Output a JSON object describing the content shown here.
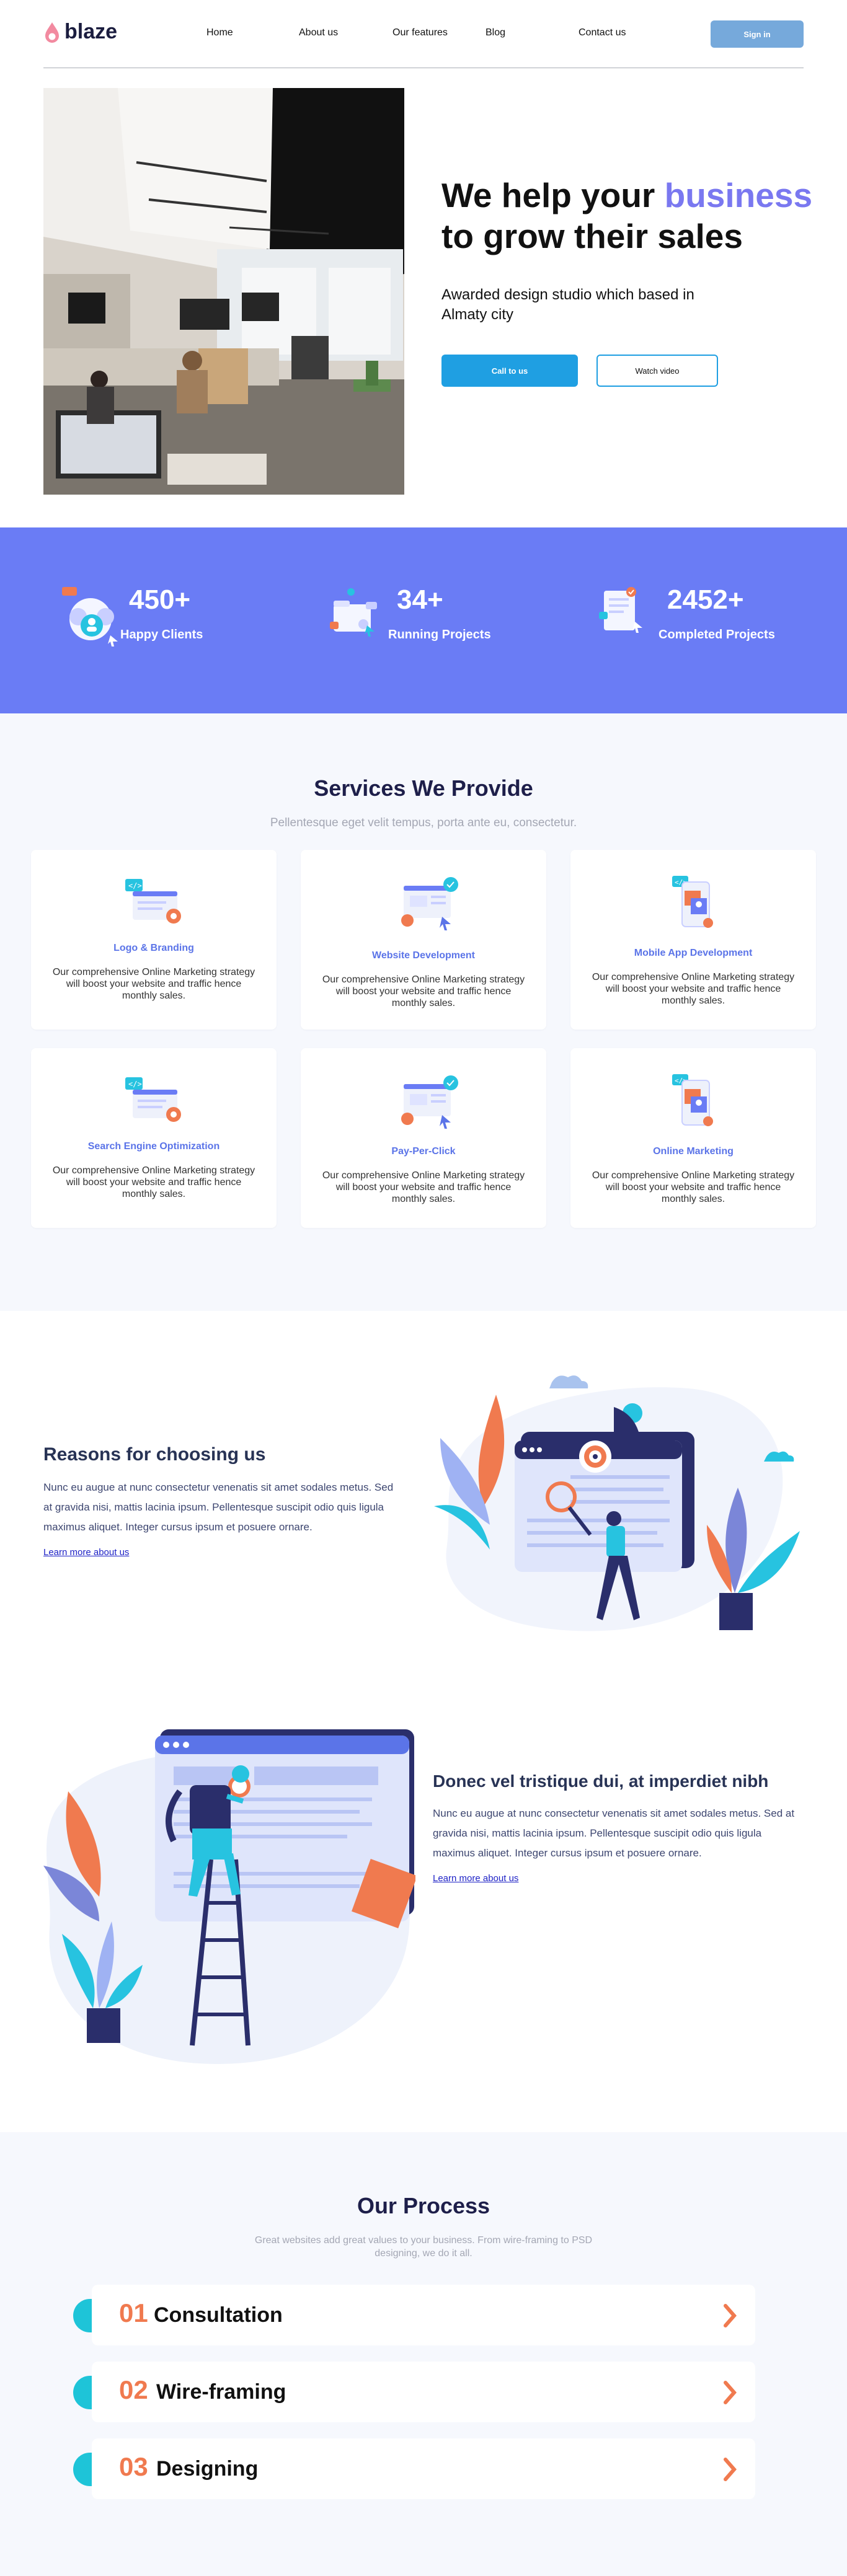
{
  "brand": {
    "name": "blaze"
  },
  "nav": {
    "items": [
      "Home",
      "About us",
      "Our features",
      "Blog",
      "Contact us"
    ],
    "signin": "Sign in"
  },
  "hero": {
    "title_prefix": "We help your ",
    "title_accent": "business",
    "title_suffix": "to grow their sales",
    "subtitle": "Awarded design studio which based in Almaty city",
    "cta_primary": "Call to us",
    "cta_secondary": "Watch video"
  },
  "stats": [
    {
      "value": "450+",
      "label": "Happy Clients"
    },
    {
      "value": "34+",
      "label": "Running Projects"
    },
    {
      "value": "2452+",
      "label": "Completed Projects"
    }
  ],
  "services": {
    "title": "Services We Provide",
    "subtitle": "Pellentesque eget velit tempus, porta ante eu, consectetur.",
    "items": [
      {
        "title": "Logo & Branding",
        "desc": "Our comprehensive Online Marketing strategy will boost your website and traffic hence monthly sales.",
        "icon": "code-window-icon"
      },
      {
        "title": "Website Development",
        "desc": "Our comprehensive Online Marketing strategy will boost your website and traffic hence monthly sales.",
        "icon": "browser-window-icon"
      },
      {
        "title": "Mobile App Development",
        "desc": "Our comprehensive Online Marketing strategy will boost your website and traffic hence monthly sales.",
        "icon": "mobile-app-icon"
      },
      {
        "title": "Search Engine Optimization",
        "desc": "Our comprehensive Online Marketing strategy will boost your website and traffic hence monthly sales.",
        "icon": "code-window-icon"
      },
      {
        "title": "Pay-Per-Click",
        "desc": "Our comprehensive Online Marketing strategy will boost your website and traffic hence monthly sales.",
        "icon": "browser-window-icon"
      },
      {
        "title": "Online Marketing",
        "desc": "Our comprehensive Online Marketing strategy will boost your website and traffic hence monthly sales.",
        "icon": "mobile-app-icon"
      }
    ]
  },
  "reasons": {
    "title": "Reasons for choosing us",
    "text": "Nunc eu augue at nunc consectetur venenatis sit amet sodales metus. Sed at gravida nisi, mattis lacinia ipsum. Pellentesque suscipit odio quis ligula maximus aliquet. Integer cursus ipsum et posuere ornare.",
    "link": "Learn more about us"
  },
  "donec": {
    "title": "Donec vel tristique dui, at imperdiet nibh",
    "text": "Nunc eu augue at nunc consectetur venenatis sit amet sodales metus. Sed at gravida nisi, mattis lacinia ipsum. Pellentesque suscipit odio quis ligula maximus aliquet. Integer cursus ipsum et posuere ornare.",
    "link": "Learn more about us"
  },
  "process": {
    "title": "Our Process",
    "subtitle": "Great websites add great values to your business. From wire-framing to PSD designing, we do it all.",
    "steps": [
      {
        "num": "01",
        "label": "Consultation"
      },
      {
        "num": "02",
        "label": "Wire-framing"
      },
      {
        "num": "03",
        "label": "Designing"
      }
    ]
  },
  "colors": {
    "accent": "#7a78f0",
    "primary": "#1f9fe2",
    "stats_bg": "#6a7cf5",
    "orange": "#f07a4f",
    "teal": "#1ec4d8"
  }
}
